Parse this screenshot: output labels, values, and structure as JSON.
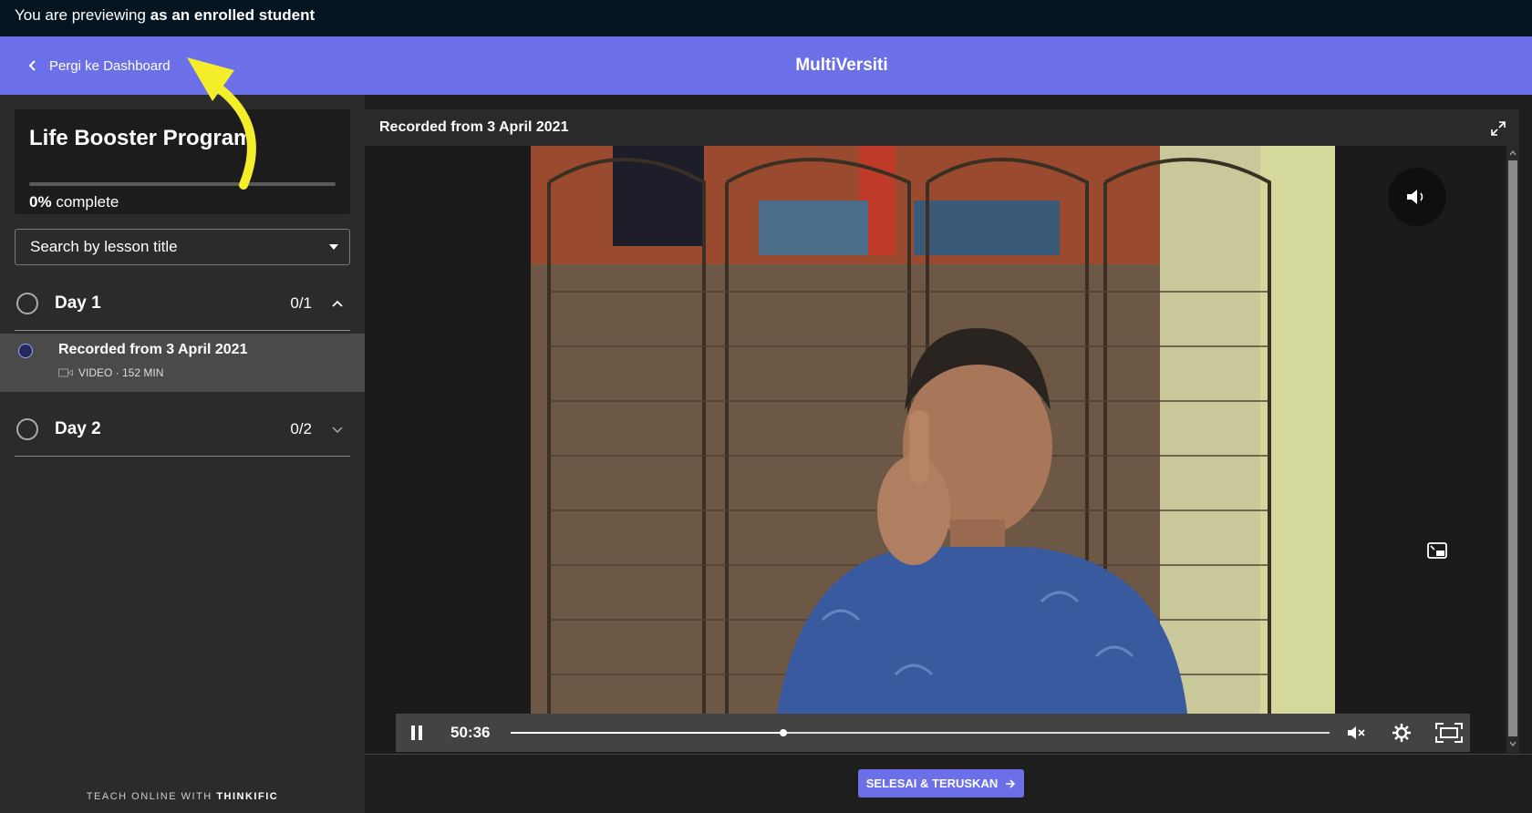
{
  "preview_bar": {
    "prefix": "You are previewing",
    "emphasis": "as an enrolled student"
  },
  "header": {
    "back_label": "Pergi ke Dashboard",
    "site_title": "MultiVersiti"
  },
  "course": {
    "title": "Life Booster Program",
    "progress_percent": 0,
    "progress_label": "0%",
    "progress_suffix": "complete"
  },
  "search": {
    "placeholder": "Search by lesson title"
  },
  "chapters": [
    {
      "title": "Day 1",
      "count": "0/1",
      "expanded": true
    },
    {
      "title": "Day 2",
      "count": "0/2",
      "expanded": false
    }
  ],
  "lesson": {
    "title": "Recorded from 3 April 2021",
    "meta": "VIDEO · 152 MIN"
  },
  "footer": {
    "prefix": "TEACH ONLINE WITH",
    "brand": "THINKIFIC"
  },
  "content": {
    "title": "Recorded from 3 April 2021"
  },
  "player": {
    "current_time": "50:36",
    "progress_fraction": 0.333
  },
  "actions": {
    "complete_label": "SELESAI & TERUSKAN"
  },
  "colors": {
    "accent": "#6b70e8",
    "preview_bar": "#041521",
    "annotation": "#f4ee2a"
  }
}
